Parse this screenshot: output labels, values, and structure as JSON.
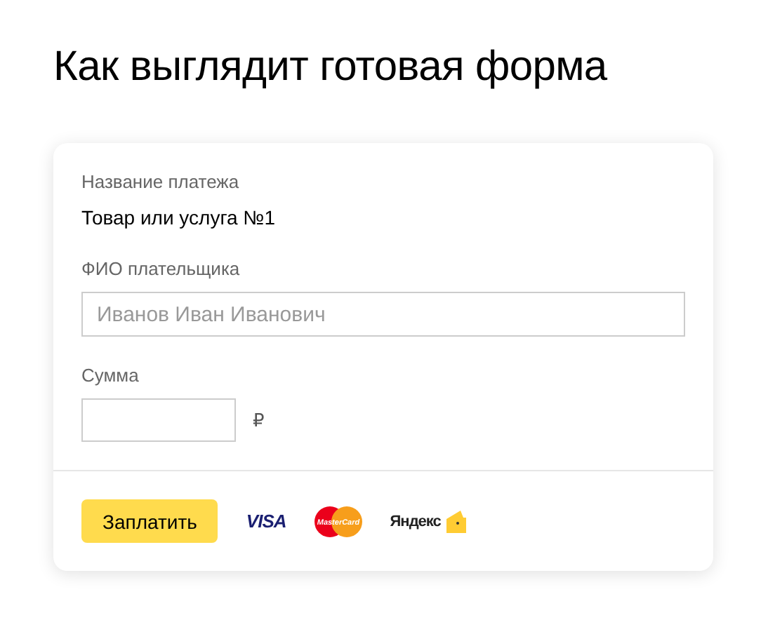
{
  "title": "Как выглядит готовая форма",
  "form": {
    "payment_name": {
      "label": "Название платежа",
      "value": "Товар или услуга №1"
    },
    "payer": {
      "label": "ФИО плательщика",
      "placeholder": "Иванов Иван Иванович"
    },
    "amount": {
      "label": "Сумма",
      "currency": "₽"
    },
    "pay_button": "Заплатить",
    "payment_methods": [
      {
        "kind": "visa",
        "text": "VISA"
      },
      {
        "kind": "mastercard",
        "text": "MasterCard"
      },
      {
        "kind": "yandex",
        "text": "Яндекс"
      }
    ]
  }
}
